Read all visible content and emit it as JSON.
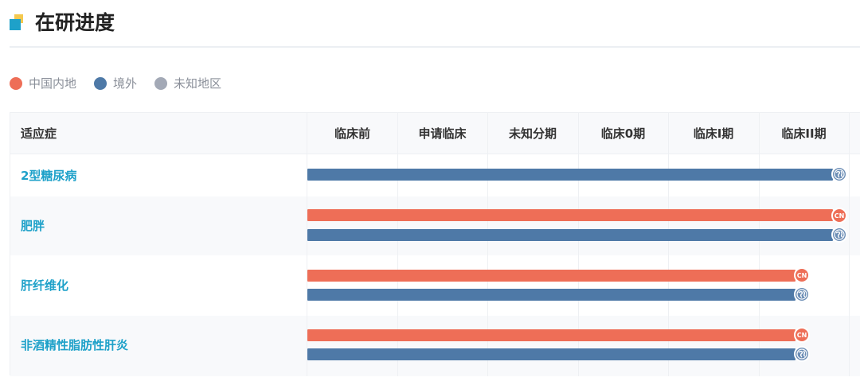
{
  "header": {
    "title": "在研进度"
  },
  "legend": [
    {
      "label": "中国内地",
      "color": "#ee6e57"
    },
    {
      "label": "境外",
      "color": "#4e79a7"
    },
    {
      "label": "未知地区",
      "color": "#a3a9b6"
    }
  ],
  "table": {
    "indication_header": "适应症",
    "stages": [
      "临床前",
      "申请临床",
      "未知分期",
      "临床0期",
      "临床I期",
      "临床II期"
    ],
    "rows": [
      {
        "indication": "2型糖尿病",
        "bars": [
          {
            "region": "境外",
            "badge_icon": "globe-icon",
            "progress_stage": "临床II期"
          }
        ]
      },
      {
        "indication": "肥胖",
        "bars": [
          {
            "region": "中国内地",
            "badge": "CN",
            "progress_stage": "临床II期"
          },
          {
            "region": "境外",
            "badge_icon": "globe-icon",
            "progress_stage": "临床II期"
          }
        ]
      },
      {
        "indication": "肝纤维化",
        "bars": [
          {
            "region": "中国内地",
            "badge": "CN",
            "progress_stage": "临床II期"
          },
          {
            "region": "境外",
            "badge_icon": "globe-icon",
            "progress_stage": "临床II期"
          }
        ]
      },
      {
        "indication": "非酒精性脂肪性肝炎",
        "bars": [
          {
            "region": "中国内地",
            "badge": "CN",
            "progress_stage": "临床II期"
          },
          {
            "region": "境外",
            "badge_icon": "globe-icon",
            "progress_stage": "临床II期"
          }
        ]
      }
    ]
  },
  "colors": {
    "accent": "#1ea1c9",
    "cn": "#ee6e57",
    "intl": "#4e79a7",
    "unknown": "#a3a9b6"
  }
}
